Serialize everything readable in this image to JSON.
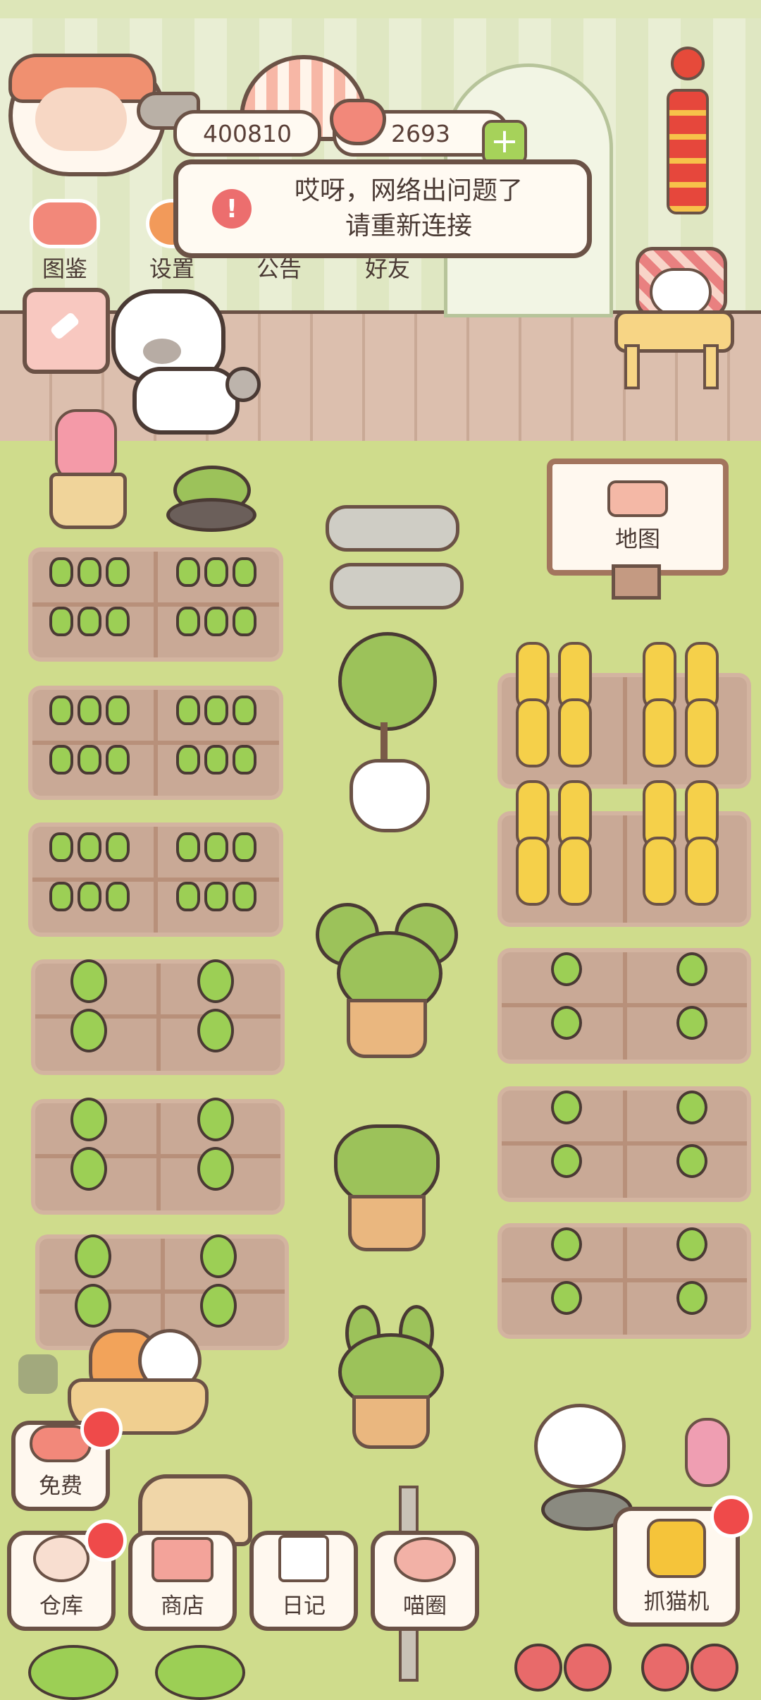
{
  "currency": {
    "fish_count": "400810",
    "heart_count": "2693"
  },
  "top_menu": [
    {
      "label": "图鉴",
      "icon": "cat-book-icon"
    },
    {
      "label": "设置",
      "icon": "gear-icon"
    },
    {
      "label": "公告",
      "icon": "notice-icon"
    },
    {
      "label": "好友",
      "icon": "friends-icon"
    }
  ],
  "dialog": {
    "line1": "哎呀，网络出问题了",
    "line2": "请重新连接"
  },
  "map_sign": {
    "label": "地图",
    "icon": "fence-map-icon"
  },
  "bottom_left": {
    "free_label": "免费"
  },
  "bottom_bar": [
    {
      "label": "仓库",
      "icon": "storage-icon"
    },
    {
      "label": "商店",
      "icon": "shop-icon"
    },
    {
      "label": "日记",
      "icon": "diary-icon"
    },
    {
      "label": "喵圈",
      "icon": "cat-planet-icon"
    }
  ],
  "claw_machine": {
    "label": "抓猫机",
    "icon": "claw-icon"
  },
  "colors": {
    "accent_red": "#ef4a4a",
    "outline_brown": "#6b5246",
    "grass": "#cfdc8c"
  }
}
